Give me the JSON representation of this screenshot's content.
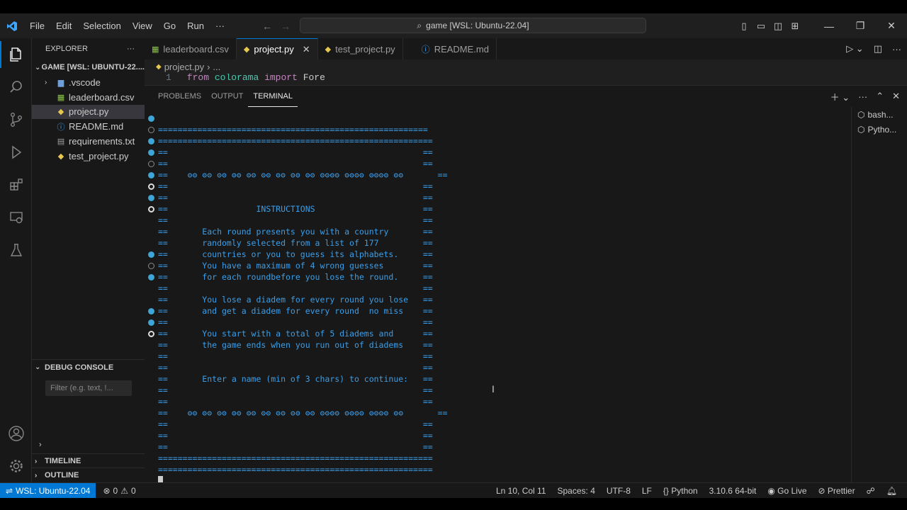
{
  "title_bar": {
    "menu": [
      "File",
      "Edit",
      "Selection",
      "View",
      "Go",
      "Run",
      "···"
    ],
    "search_text": "game [WSL: Ubuntu-22.04]"
  },
  "explorer": {
    "header": "EXPLORER",
    "more": "···",
    "folder": "GAME [WSL: UBUNTU-22....",
    "items": [
      {
        "label": ".vscode",
        "icon": "folder-icon",
        "color": "#6f9fd8"
      },
      {
        "label": "leaderboard.csv",
        "icon": "csv-icon",
        "color": "#8bc34a"
      },
      {
        "label": "project.py",
        "icon": "python-icon",
        "color": "#e6c84f"
      },
      {
        "label": "README.md",
        "icon": "info-icon",
        "color": "#3ea6ff"
      },
      {
        "label": "requirements.txt",
        "icon": "text-file-icon",
        "color": "#a0a0a0"
      },
      {
        "label": "test_project.py",
        "icon": "python-icon",
        "color": "#e6c84f"
      }
    ],
    "debug_console": "DEBUG CONSOLE",
    "filter_placeholder": "Filter (e.g. text, !...",
    "timeline": "TIMELINE",
    "outline": "OUTLINE"
  },
  "tabs": [
    {
      "label": "leaderboard.csv",
      "icon": "csv-icon"
    },
    {
      "label": "project.py",
      "icon": "python-icon",
      "active": true
    },
    {
      "label": "test_project.py",
      "icon": "python-icon"
    },
    {
      "label": "README.md",
      "icon": "info-icon"
    }
  ],
  "breadcrumb": {
    "file": "project.py",
    "rest": "..."
  },
  "code": {
    "line_no": "1",
    "kw1": "from",
    "module": "colorama",
    "kw2": "import",
    "name": "Fore"
  },
  "panel": {
    "tabs": [
      "PROBLEMS",
      "OUTPUT",
      "TERMINAL"
    ],
    "active_tab": "TERMINAL",
    "terminals": [
      "bash...",
      "Pytho..."
    ]
  },
  "terminal": {
    "lines": [
      "",
      "=======================================================",
      "========================================================",
      "==                                                    ==",
      "==                                                    ==",
      "==    ʘʘ ʘʘ ʘʘ ʘʘ ʘʘ ʘʘ ʘʘ ʘʘ ʘʘ ʘʘʘʘ ʘʘʘʘ ʘʘʘʘ ʘʘ       ==",
      "==                                                    ==",
      "==                                                    ==",
      "==                  INSTRUCTIONS                      ==",
      "==                                                    ==",
      "==       Each round presents you with a country       ==",
      "==       randomly selected from a list of 177         ==",
      "==       countries or you to guess its alphabets.     ==",
      "==       You have a maximum of 4 wrong guesses        ==",
      "==       for each roundbefore you lose the round.     ==",
      "==                                                    ==",
      "==       You lose a diadem for every round you lose   ==",
      "==       and get a diadem for every round  no miss    ==",
      "==                                                    ==",
      "==       You start with a total of 5 diadems and      ==",
      "==       the game ends when you run out of diadems    ==",
      "==                                                    ==",
      "==                                                    ==",
      "==       Enter a name (min of 3 chars) to continue:   ==",
      "==                                                    ==",
      "==                                                    ==",
      "==    ʘʘ ʘʘ ʘʘ ʘʘ ʘʘ ʘʘ ʘʘ ʘʘ ʘʘ ʘʘʘʘ ʘʘʘʘ ʘʘʘʘ ʘʘ       ==",
      "==                                                    ==",
      "==                                                    ==",
      "==                                                    ==",
      "========================================================",
      "========================================================"
    ],
    "decorations": [
      "filled",
      "hollow",
      "filled",
      "filled",
      "hollow",
      "filled",
      "hollow-bright",
      "filled",
      "hollow-bright",
      "",
      "",
      "",
      "filled",
      "hollow",
      "filled",
      "",
      "",
      "filled",
      "filled",
      "hollow-bright",
      "",
      "",
      "",
      "",
      "",
      "",
      "",
      "",
      "",
      "",
      "",
      "",
      ""
    ]
  },
  "status_bar": {
    "remote": "WSL: Ubuntu-22.04",
    "errors": "0",
    "warnings": "0",
    "position": "Ln 10, Col 11",
    "spaces": "Spaces: 4",
    "encoding": "UTF-8",
    "eol": "LF",
    "language": "Python",
    "interpreter": "3.10.6 64-bit",
    "golive": "Go Live",
    "prettier": "Prettier"
  }
}
